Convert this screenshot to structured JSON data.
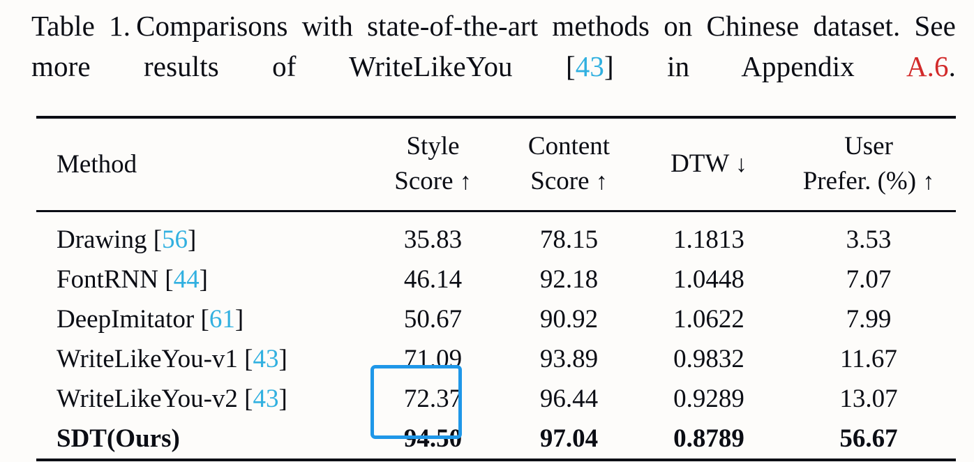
{
  "caption": {
    "label": "Table 1.",
    "text_before_cite": "Comparisons with state-of-the-art methods on Chinese dataset. See more results of WriteLikeYou",
    "citation_open": "[",
    "citation_number": "43",
    "citation_close": "]",
    "text_after_cite": "in Appendix",
    "appendix_ref": "A.6",
    "end_punctuation": ".",
    "cite_color": "#31b0e0",
    "appendix_color": "#d22a2a"
  },
  "table": {
    "columns": [
      {
        "key": "method",
        "line1": "Method",
        "line2": "",
        "arrow": ""
      },
      {
        "key": "style",
        "line1": "Style",
        "line2": "Score",
        "arrow": "↑"
      },
      {
        "key": "content",
        "line1": "Content",
        "line2": "Score",
        "arrow": "↑"
      },
      {
        "key": "dtw",
        "line1": "",
        "line2": "DTW",
        "arrow": "↓"
      },
      {
        "key": "user",
        "line1": "User",
        "line2": "Prefer. (%)",
        "arrow": "↑"
      }
    ],
    "rows": [
      {
        "method": "Drawing",
        "cite_open": "[",
        "cite": "56",
        "cite_close": "]",
        "style": "35.83",
        "content": "78.15",
        "dtw": "1.1813",
        "user": "3.53",
        "bold": false
      },
      {
        "method": "FontRNN",
        "cite_open": "[",
        "cite": "44",
        "cite_close": "]",
        "style": "46.14",
        "content": "92.18",
        "dtw": "1.0448",
        "user": "7.07",
        "bold": false
      },
      {
        "method": "DeepImitator",
        "cite_open": "[",
        "cite": "61",
        "cite_close": "]",
        "style": "50.67",
        "content": "90.92",
        "dtw": "1.0622",
        "user": "7.99",
        "bold": false
      },
      {
        "method": "WriteLikeYou-v1",
        "cite_open": "[",
        "cite": "43",
        "cite_close": "]",
        "style": "71.09",
        "content": "93.89",
        "dtw": "0.9832",
        "user": "11.67",
        "bold": false
      },
      {
        "method": "WriteLikeYou-v2",
        "cite_open": "[",
        "cite": "43",
        "cite_close": "]",
        "style": "72.37",
        "content": "96.44",
        "dtw": "0.9289",
        "user": "13.07",
        "bold": false
      },
      {
        "method": "SDT(Ours)",
        "cite_open": "",
        "cite": "",
        "cite_close": "",
        "style": "94.50",
        "content": "97.04",
        "dtw": "0.8789",
        "user": "56.67",
        "bold": true
      }
    ],
    "highlight": {
      "column": "style",
      "rows": [
        "WriteLikeYou-v2",
        "SDT(Ours)"
      ],
      "color": "#1f97e8"
    }
  }
}
